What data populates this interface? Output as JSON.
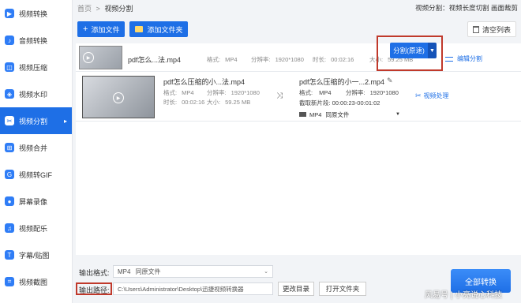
{
  "sidebar": {
    "items": [
      {
        "label": "视频转换",
        "icon": "video-convert-icon"
      },
      {
        "label": "音频转换",
        "icon": "audio-convert-icon"
      },
      {
        "label": "视频压缩",
        "icon": "video-compress-icon"
      },
      {
        "label": "视频水印",
        "icon": "video-watermark-icon"
      },
      {
        "label": "视频分割",
        "icon": "video-split-icon",
        "active": true
      },
      {
        "label": "视频合并",
        "icon": "video-merge-icon"
      },
      {
        "label": "视频转GIF",
        "icon": "gif-icon"
      },
      {
        "label": "屏幕录像",
        "icon": "screen-record-icon"
      },
      {
        "label": "视频配乐",
        "icon": "music-icon"
      },
      {
        "label": "字幕/贴图",
        "icon": "subtitle-icon"
      },
      {
        "label": "视频截图",
        "icon": "screenshot-icon"
      }
    ]
  },
  "topbar": {
    "crumb_home": "首页",
    "crumb_sep": ">",
    "crumb_current": "视频分割",
    "hint": "视频分割：视频长度切割 画面裁剪"
  },
  "toolbar": {
    "add_file": "添加文件",
    "add_folder": "添加文件夹",
    "clear_list": "清空列表"
  },
  "file_row_1": {
    "name": "pdf怎么...法.mp4",
    "format_label": "格式:",
    "format": "MP4",
    "resolution_label": "分辨率:",
    "resolution": "1920*1080",
    "duration_label": "时长:",
    "duration": "00:02:16",
    "size_label": "大小:",
    "size": "59.25 MB",
    "edit_split": "编辑分割"
  },
  "file_row_2": {
    "source_name": "pdf怎么压缩的小...法.mp4",
    "format_label": "格式:",
    "format": "MP4",
    "resolution_label": "分辨率:",
    "resolution": "1920*1080",
    "duration_label": "时长:",
    "duration": "00:02:16",
    "size_label": "大小:",
    "size": "59.25 MB",
    "target_name": "pdf怎么压缩的小一...2.mp4",
    "target_format_label": "格式:",
    "target_format": "MP4",
    "target_resolution_label": "分辨率:",
    "target_resolution": "1920*1080",
    "clip_label": "截取新片段:",
    "clip_range": "00:00:23-00:01:02",
    "output_format": "MP4",
    "output_quality": "同原文件",
    "video_process": "视频处理",
    "split_button": "分割(原速)"
  },
  "bottom": {
    "output_format_label": "输出格式:",
    "output_format_value": "MP4",
    "output_format_quality": "同原文件",
    "output_path_label": "输出路径:",
    "output_path": "C:\\Users\\Administrator\\Desktop\\迅捷视频转换器",
    "change_dir": "更改目录",
    "open_folder": "打开文件夹",
    "convert_all": "全部转换"
  },
  "watermark": "风易号 | 小亮说心科技",
  "colors": {
    "accent": "#1e6fe6",
    "highlight_box": "#c0392b"
  }
}
